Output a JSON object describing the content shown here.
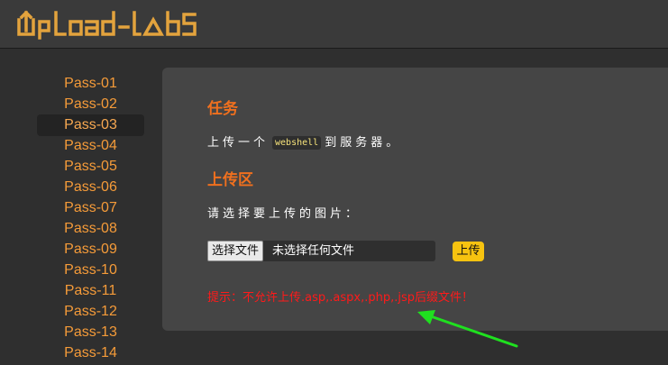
{
  "header": {
    "logo_text": "UpLoad-labs",
    "logo_color": "#e3a33d"
  },
  "sidebar": {
    "items": [
      {
        "label": "Pass-01",
        "active": false
      },
      {
        "label": "Pass-02",
        "active": false
      },
      {
        "label": "Pass-03",
        "active": true
      },
      {
        "label": "Pass-04",
        "active": false
      },
      {
        "label": "Pass-05",
        "active": false
      },
      {
        "label": "Pass-06",
        "active": false
      },
      {
        "label": "Pass-07",
        "active": false
      },
      {
        "label": "Pass-08",
        "active": false
      },
      {
        "label": "Pass-09",
        "active": false
      },
      {
        "label": "Pass-10",
        "active": false
      },
      {
        "label": "Pass-11",
        "active": false
      },
      {
        "label": "Pass-12",
        "active": false
      },
      {
        "label": "Pass-13",
        "active": false
      },
      {
        "label": "Pass-14",
        "active": false
      }
    ]
  },
  "main": {
    "task_title": "任务",
    "task_text_before": "上传一个",
    "task_code": "webshell",
    "task_text_after": "到服务器。",
    "upload_title": "上传区",
    "upload_prompt": "请选择要上传的图片：",
    "file_button_label": "选择文件",
    "file_status": "未选择任何文件",
    "upload_button_label": "上传",
    "message": "提示：不允许上传.asp,.aspx,.php,.jsp后缀文件！"
  },
  "colors": {
    "accent_orange": "#f0701e",
    "nav_link": "#f59b39",
    "upload_button": "#f7c310",
    "error_text": "#ff1a1a",
    "annotation_arrow": "#1fe01f"
  }
}
